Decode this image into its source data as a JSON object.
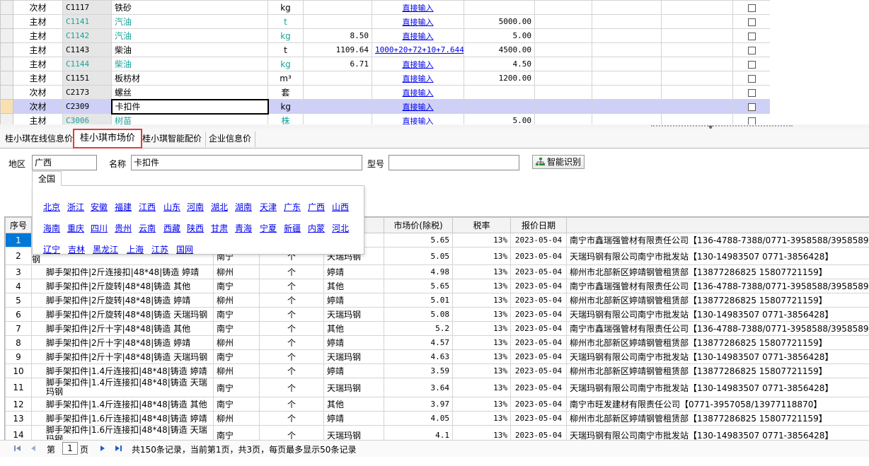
{
  "top_grid": {
    "rows": [
      {
        "type": "次材",
        "code": "C1117",
        "name": "铁砂",
        "unit": "kg",
        "price": "",
        "formula": "直接输入",
        "formula_link": true,
        "qty": "",
        "teal": false
      },
      {
        "type": "主材",
        "code": "C1141",
        "name": "汽油",
        "unit": "t",
        "price": "",
        "formula": "直接输入",
        "formula_link": true,
        "qty": "5000.00",
        "teal": true
      },
      {
        "type": "主材",
        "code": "C1142",
        "name": "汽油",
        "unit": "kg",
        "price": "8.50",
        "formula": "直接输入",
        "formula_link": true,
        "qty": "5.00",
        "teal": true
      },
      {
        "type": "主材",
        "code": "C1143",
        "name": "柴油",
        "unit": "t",
        "price": "1109.64",
        "formula": "1000+20+72+10+7.644",
        "formula_link": true,
        "qty": "4500.00",
        "teal": false
      },
      {
        "type": "主材",
        "code": "C1144",
        "name": "柴油",
        "unit": "kg",
        "price": "6.71",
        "formula": "直接输入",
        "formula_link": true,
        "qty": "4.50",
        "teal": true
      },
      {
        "type": "主材",
        "code": "C1151",
        "name": "板枋材",
        "unit": "m³",
        "price": "",
        "formula": "直接输入",
        "formula_link": true,
        "qty": "1200.00",
        "teal": false
      },
      {
        "type": "次材",
        "code": "C2173",
        "name": "螺丝",
        "unit": "套",
        "price": "",
        "formula": "直接输入",
        "formula_link": true,
        "qty": "",
        "teal": false
      },
      {
        "type": "次材",
        "code": "C2309",
        "name": "卡扣件",
        "unit": "kg",
        "price": "",
        "formula": "直接输入",
        "formula_link": true,
        "qty": "",
        "teal": false,
        "selected": true
      },
      {
        "type": "主材",
        "code": "C3006",
        "name": "树苗",
        "unit": "株",
        "price": "",
        "formula": "直接输入",
        "formula_link": true,
        "qty": "5.00",
        "teal": true
      }
    ]
  },
  "tabs": [
    {
      "label": "桂小琪在线信息价",
      "active": false
    },
    {
      "label": "桂小琪市场价",
      "active": true
    },
    {
      "label": "桂小琪智能配价",
      "active": false
    },
    {
      "label": "企业信息价",
      "active": false
    }
  ],
  "filters": {
    "region_label": "地区",
    "region_value": "广西",
    "name_label": "名称",
    "name_value": "卡扣件",
    "model_label": "型号",
    "model_value": "",
    "smart_button": "智能识别"
  },
  "region_popup": {
    "tab_label": "全国",
    "rows": [
      [
        "北京",
        "浙江",
        "安徽",
        "福建",
        "江西",
        "山东",
        "河南",
        "湖北",
        "湖南",
        "天津",
        "广东",
        "广西",
        "山西"
      ],
      [
        "海南",
        "重庆",
        "四川",
        "贵州",
        "云南",
        "西藏",
        "陕西",
        "甘肃",
        "青海",
        "宁夏",
        "新疆",
        "内蒙",
        "河北"
      ],
      [
        "辽宁",
        "吉林",
        "黑龙江",
        "上海",
        "江苏",
        "国网"
      ]
    ]
  },
  "result_grid": {
    "headers": {
      "seq": "序号",
      "name": "",
      "region": "",
      "unit": "",
      "brand": "",
      "price": "市场价(除税)",
      "tax": "税率",
      "date": "报价日期",
      "supplier": ""
    },
    "rows": [
      {
        "seq": "1",
        "name": "",
        "region": "",
        "unit": "",
        "brand": "",
        "price": "5.65",
        "tax": "13%",
        "date": "2023-05-04",
        "supplier": "南宁市鑫瑞强管材有限责任公司【136-4788-7388/0771-3958588/3958589】",
        "selected": true
      },
      {
        "seq": "2",
        "name": "钢",
        "region": "南宁",
        "unit": "个",
        "brand": "天瑞玛钢",
        "price": "5.05",
        "tax": "13%",
        "date": "2023-05-04",
        "supplier": "天瑞玛钢有限公司南宁市批发站【130-14983507 0771-3856428】",
        "partial": true
      },
      {
        "seq": "3",
        "name": "脚手架扣件|2斤连接扣|48*48|铸造 婷靖",
        "region": "柳州",
        "unit": "个",
        "brand": "婷靖",
        "price": "4.98",
        "tax": "13%",
        "date": "2023-05-04",
        "supplier": "柳州市北部新区婷靖钢管租赁部【13877286825 15807721159】"
      },
      {
        "seq": "4",
        "name": "脚手架扣件|2斤旋转|48*48|铸造 其他",
        "region": "南宁",
        "unit": "个",
        "brand": "其他",
        "price": "5.65",
        "tax": "13%",
        "date": "2023-05-04",
        "supplier": "南宁市鑫瑞强管材有限责任公司【136-4788-7388/0771-3958588/3958589】"
      },
      {
        "seq": "5",
        "name": "脚手架扣件|2斤旋转|48*48|铸造 婷靖",
        "region": "柳州",
        "unit": "个",
        "brand": "婷靖",
        "price": "5.01",
        "tax": "13%",
        "date": "2023-05-04",
        "supplier": "柳州市北部新区婷靖钢管租赁部【13877286825 15807721159】"
      },
      {
        "seq": "6",
        "name": "脚手架扣件|2斤旋转|48*48|铸造 天瑞玛钢",
        "region": "南宁",
        "unit": "个",
        "brand": "天瑞玛钢",
        "price": "5.08",
        "tax": "13%",
        "date": "2023-05-04",
        "supplier": "天瑞玛钢有限公司南宁市批发站【130-14983507 0771-3856428】"
      },
      {
        "seq": "7",
        "name": "脚手架扣件|2斤十字|48*48|铸造 其他",
        "region": "南宁",
        "unit": "个",
        "brand": "其他",
        "price": "5.2",
        "tax": "13%",
        "date": "2023-05-04",
        "supplier": "南宁市鑫瑞强管材有限责任公司【136-4788-7388/0771-3958588/3958589】"
      },
      {
        "seq": "8",
        "name": "脚手架扣件|2斤十字|48*48|铸造 婷靖",
        "region": "柳州",
        "unit": "个",
        "brand": "婷靖",
        "price": "4.57",
        "tax": "13%",
        "date": "2023-05-04",
        "supplier": "柳州市北部新区婷靖钢管租赁部【13877286825 15807721159】"
      },
      {
        "seq": "9",
        "name": "脚手架扣件|2斤十字|48*48|铸造 天瑞玛钢",
        "region": "南宁",
        "unit": "个",
        "brand": "天瑞玛钢",
        "price": "4.63",
        "tax": "13%",
        "date": "2023-05-04",
        "supplier": "天瑞玛钢有限公司南宁市批发站【130-14983507 0771-3856428】"
      },
      {
        "seq": "10",
        "name": "脚手架扣件|1.4斤连接扣|48*48|铸造 婷靖",
        "region": "柳州",
        "unit": "个",
        "brand": "婷靖",
        "price": "3.59",
        "tax": "13%",
        "date": "2023-05-04",
        "supplier": "柳州市北部新区婷靖钢管租赁部【13877286825 15807721159】"
      },
      {
        "seq": "11",
        "name": "脚手架扣件|1.4斤连接扣|48*48|铸造 天瑞玛钢",
        "region": "南宁",
        "unit": "个",
        "brand": "天瑞玛钢",
        "price": "3.64",
        "tax": "13%",
        "date": "2023-05-04",
        "supplier": "天瑞玛钢有限公司南宁市批发站【130-14983507 0771-3856428】",
        "tall": true
      },
      {
        "seq": "12",
        "name": "脚手架扣件|1.4斤连接扣|48*48|铸造 其他",
        "region": "南宁",
        "unit": "个",
        "brand": "其他",
        "price": "3.97",
        "tax": "13%",
        "date": "2023-05-04",
        "supplier": "南宁市旺发建材有限责任公司【0771-3957058/13977118870】"
      },
      {
        "seq": "13",
        "name": "脚手架扣件|1.6斤连接扣|48*48|铸造 婷靖",
        "region": "柳州",
        "unit": "个",
        "brand": "婷靖",
        "price": "4.05",
        "tax": "13%",
        "date": "2023-05-04",
        "supplier": "柳州市北部新区婷靖钢管租赁部【13877286825 15807721159】"
      },
      {
        "seq": "14",
        "name": "脚手架扣件|1.6斤连接扣|48*48|铸造 天瑞玛钢",
        "region": "南宁",
        "unit": "个",
        "brand": "天瑞玛钢",
        "price": "4.1",
        "tax": "13%",
        "date": "2023-05-04",
        "supplier": "天瑞玛钢有限公司南宁市批发站【130-14983507 0771-3856428】",
        "tall": true
      }
    ]
  },
  "pager": {
    "page_prefix": "第",
    "page_value": "1",
    "page_suffix": "页",
    "summary": "共150条记录，当前第1页，共3页，每页最多显示50条记录"
  }
}
